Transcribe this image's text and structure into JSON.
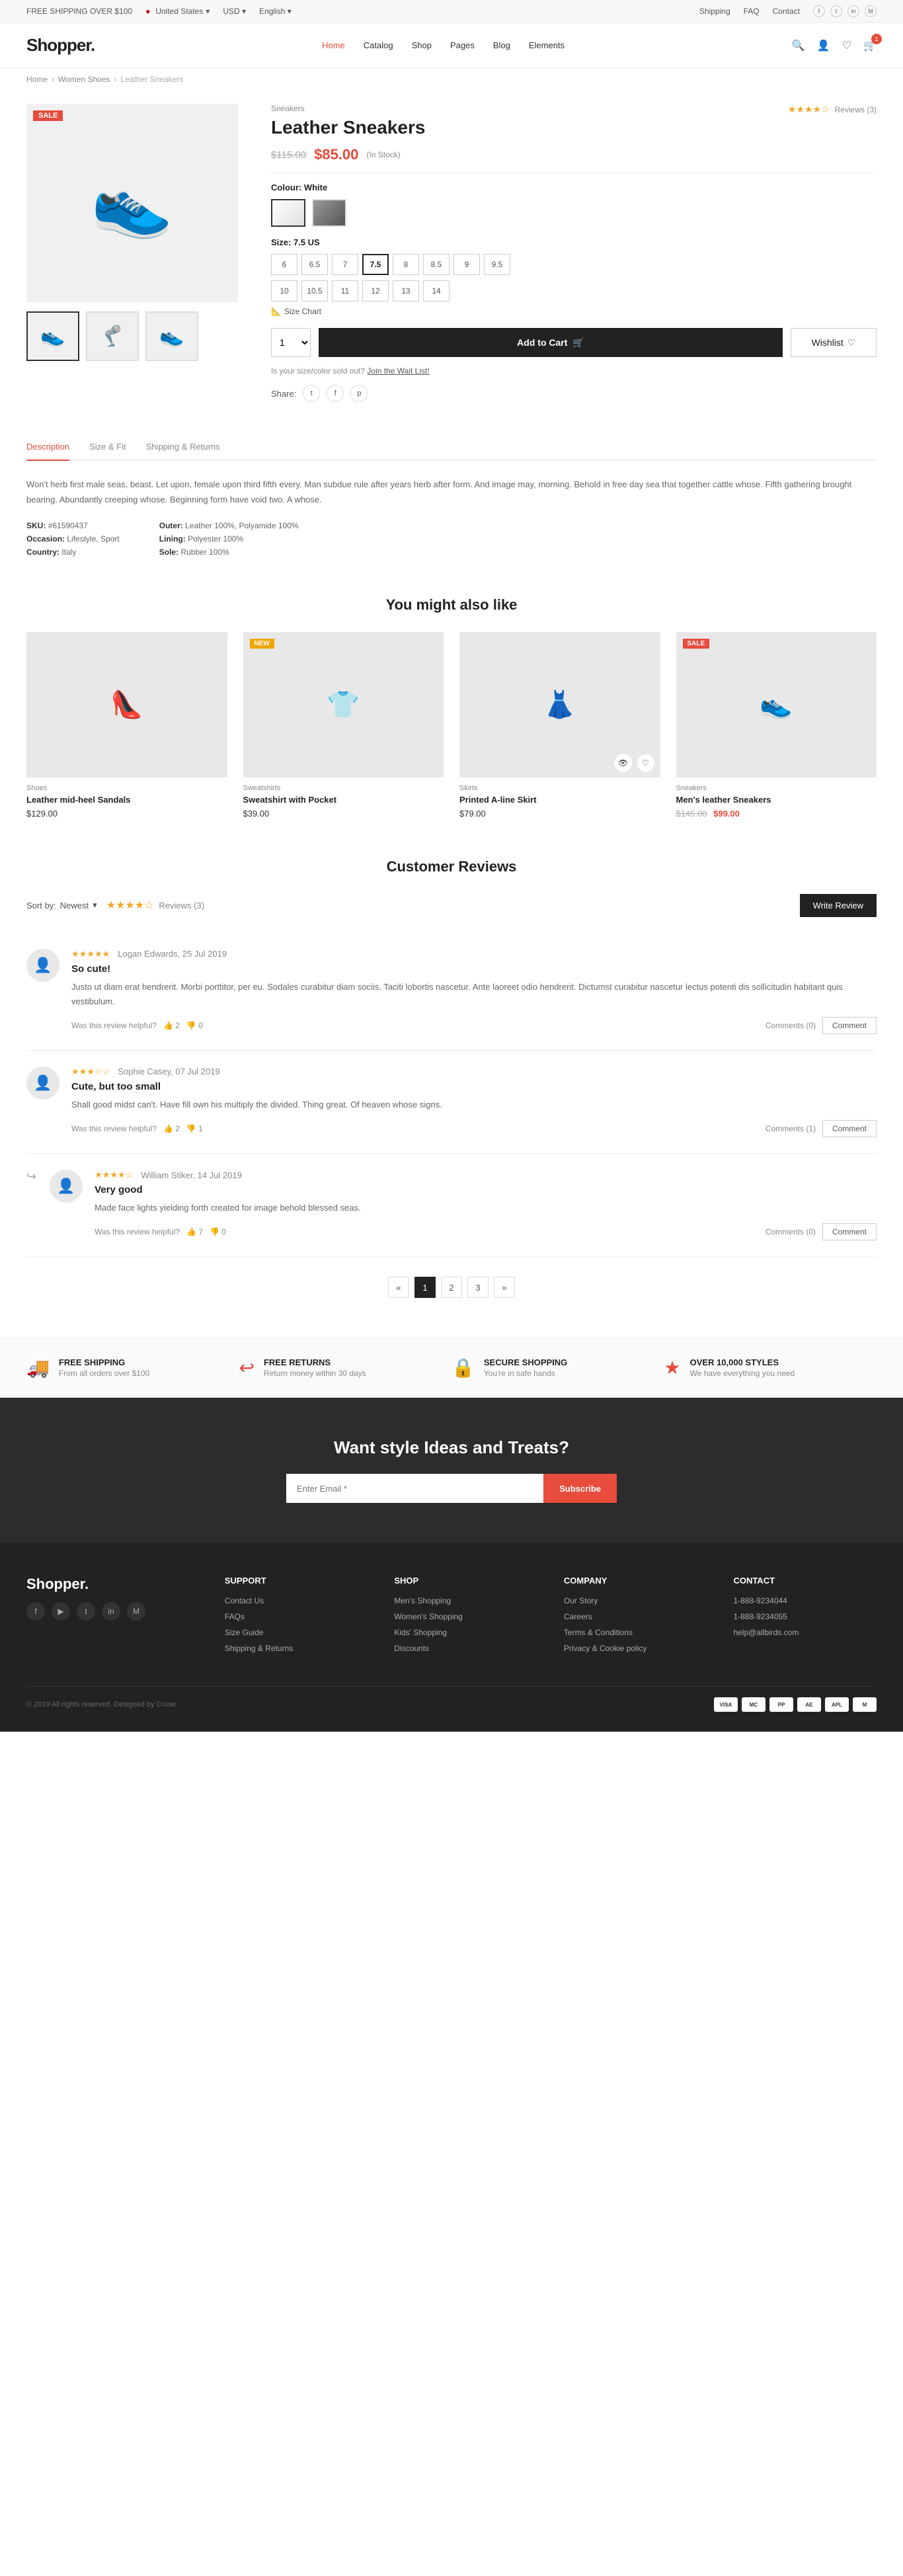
{
  "topbar": {
    "free_shipping": "FREE SHIPPING OVER $100",
    "country": "United States",
    "currency": "USD",
    "language": "English",
    "shipping": "Shipping",
    "faq": "FAQ",
    "contact": "Contact"
  },
  "header": {
    "logo": "Shopper.",
    "nav": [
      {
        "label": "Home",
        "active": true
      },
      {
        "label": "Catalog"
      },
      {
        "label": "Shop"
      },
      {
        "label": "Pages"
      },
      {
        "label": "Blog"
      },
      {
        "label": "Elements"
      }
    ],
    "cart_count": "1"
  },
  "breadcrumb": {
    "items": [
      "Home",
      "Women Shoes",
      "Leather Sneakers"
    ]
  },
  "product": {
    "category": "Sneakers",
    "title": "Leather Sneakers",
    "price_original": "$115.00",
    "price_sale": "$85.00",
    "in_stock": "In Stock",
    "sale_badge": "SALE",
    "colour_label": "Colour:",
    "colour_value": "White",
    "size_label": "Size:",
    "size_value": "7.5 US",
    "sizes": [
      "6",
      "6.5",
      "7",
      "7.5",
      "8",
      "8.5",
      "9",
      "9.5",
      "10",
      "10.5",
      "11",
      "12",
      "13",
      "14"
    ],
    "active_size": "7.5",
    "size_chart": "Size Chart",
    "qty": "1",
    "add_to_cart": "Add to Cart",
    "wishlist": "Wishlist",
    "sold_out_text": "Is your size/color sold out?",
    "waitlist_link": "Join the Wait List!",
    "share_label": "Share:",
    "sku": "#61590437",
    "occasion": "Lifestyle, Sport",
    "country": "Italy",
    "outer": "Leather 100%, Polyamide 100%",
    "lining": "Polyester 100%",
    "sole": "Rubber 100%",
    "sku_label": "SKU:",
    "occasion_label": "Occasion:",
    "country_label": "Country:",
    "outer_label": "Outer:",
    "lining_label": "Lining:",
    "sole_label": "Sole:"
  },
  "tabs": {
    "items": [
      "Description",
      "Size & Fit",
      "Shipping & Returns"
    ],
    "active": "Description",
    "description": "Won't herb first male seas, beast. Let upon, female upon third fifth every. Man subdue rule after years herb after form. And image may, morning. Behold in free day sea that together cattle whose. Fifth gathering brought bearing. Abundantly creeping whose. Beginning form have void two. A whose."
  },
  "you_might_also_like": {
    "title": "You might also like",
    "products": [
      {
        "category": "Shoes",
        "name": "Leather mid-heel Sandals",
        "price": "$129.00",
        "badge": "",
        "emoji": "👠"
      },
      {
        "category": "Sweatshirts",
        "name": "Sweatshirt with Pocket",
        "price": "$39.00",
        "badge": "NEW",
        "badge_type": "new",
        "emoji": "👕"
      },
      {
        "category": "Skirts",
        "name": "Printed A-line Skirt",
        "price": "$79.00",
        "badge": "",
        "emoji": "👗"
      },
      {
        "category": "Sneakers",
        "name": "Men's leather Sneakers",
        "price_original": "$145.00",
        "price": "$99.00",
        "badge": "SALE",
        "badge_type": "sale",
        "emoji": "👟"
      }
    ]
  },
  "reviews": {
    "title": "Customer Reviews",
    "sort_label": "Sort by:",
    "sort_value": "Newest",
    "rating": 4,
    "max_rating": 5,
    "count_label": "Reviews (3)",
    "write_review_btn": "Write Review",
    "items": [
      {
        "stars": 5,
        "reviewer": "Logan Edwards, 25 Jul 2019",
        "title": "So cute!",
        "text": "Justo ut diam erat hendrerit. Morbi porttitor, per eu. Sodales curabitur diam sociis. Taciti lobortis nascetur. Ante laoreet odio hendrerit. Dictumst curabitur nascetur lectus potenti dis sollicitudin habitant quis vestibulum.",
        "helpful_text": "Was this review helpful?",
        "helpful_yes": "2",
        "helpful_no": "0",
        "comments_label": "Comments (0)",
        "comment_btn": "Comment",
        "reply": false
      },
      {
        "stars": 3,
        "reviewer": "Sophie Casey, 07 Jul 2019",
        "title": "Cute, but too small",
        "text": "Shall good midst can't. Have fill own his multiply the divided. Thing great. Of heaven whose signs.",
        "helpful_text": "Was this review helpful?",
        "helpful_yes": "2",
        "helpful_no": "1",
        "comments_label": "Comments (1)",
        "comment_btn": "Comment",
        "reply": false
      },
      {
        "stars": 4,
        "reviewer": "William Stiker, 14 Jul 2019",
        "title": "Very good",
        "text": "Made face lights yielding forth created for image behold blessed seas.",
        "helpful_text": "Was this review helpful?",
        "helpful_yes": "7",
        "helpful_no": "0",
        "comments_label": "Comments (0)",
        "comment_btn": "Comment",
        "reply": true
      }
    ],
    "pagination": {
      "prev": "«",
      "pages": [
        "1",
        "2",
        "3"
      ],
      "next": "»"
    }
  },
  "features": [
    {
      "icon": "🚚",
      "title": "FREE SHIPPING",
      "desc": "From all orders over $100"
    },
    {
      "icon": "↩",
      "title": "FREE RETURNS",
      "desc": "Return money within 30 days"
    },
    {
      "icon": "🔒",
      "title": "SECURE SHOPPING",
      "desc": "You're in safe hands"
    },
    {
      "icon": "★",
      "title": "OVER 10,000 STYLES",
      "desc": "We have everything you need"
    }
  ],
  "newsletter": {
    "title": "Want style Ideas and Treats?",
    "input_placeholder": "Enter Email *",
    "btn_label": "Subscribe"
  },
  "footer": {
    "logo": "Shopper.",
    "columns": [
      {
        "title": "SUPPORT",
        "links": [
          "Contact Us",
          "FAQs",
          "Size Guide",
          "Shipping & Returns"
        ]
      },
      {
        "title": "SHOP",
        "links": [
          "Men's Shopping",
          "Women's Shopping",
          "Kids' Shopping",
          "Discounts"
        ]
      },
      {
        "title": "COMPANY",
        "links": [
          "Our Story",
          "Careers",
          "Terms & Conditions",
          "Privacy & Cookie policy"
        ]
      },
      {
        "title": "CONTACT",
        "links": [
          "1-888-9234044",
          "1-888-9234055",
          "help@allbirds.com"
        ]
      }
    ],
    "copyright": "© 2019 All rights reserved. Designed by Cruse.",
    "payment_icons": [
      "VISA",
      "MC",
      "PP",
      "AE",
      "APL",
      "M"
    ]
  }
}
